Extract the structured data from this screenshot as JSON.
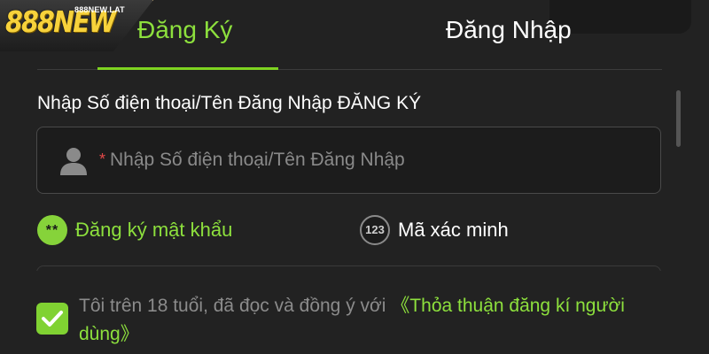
{
  "logo": {
    "text": "888NEW",
    "sub": "888NEW.LAT"
  },
  "tabs": [
    {
      "label": "Đăng Ký",
      "active": true
    },
    {
      "label": "Đăng Nhập",
      "active": false
    }
  ],
  "form": {
    "field_label": "Nhập Số điện thoại/Tên Đăng Nhập ĐĂNG KÝ",
    "input": {
      "required_mark": "*",
      "placeholder": "Nhập Số điện thoại/Tên Đăng Nhập",
      "value": "",
      "icon": "user-icon"
    },
    "options": [
      {
        "icon_text": "**",
        "label": "Đăng ký mật khẩu",
        "selected": true
      },
      {
        "icon_text": "123",
        "label": "Mã xác minh",
        "selected": false
      }
    ]
  },
  "agreement": {
    "checked": true,
    "text": "Tôi trên 18 tuổi, đã đọc và đồng ý với ",
    "link": "《Thỏa thuận đăng kí người dùng》"
  },
  "colors": {
    "accent": "#7ed321",
    "background": "#222222",
    "required": "#e34848"
  }
}
